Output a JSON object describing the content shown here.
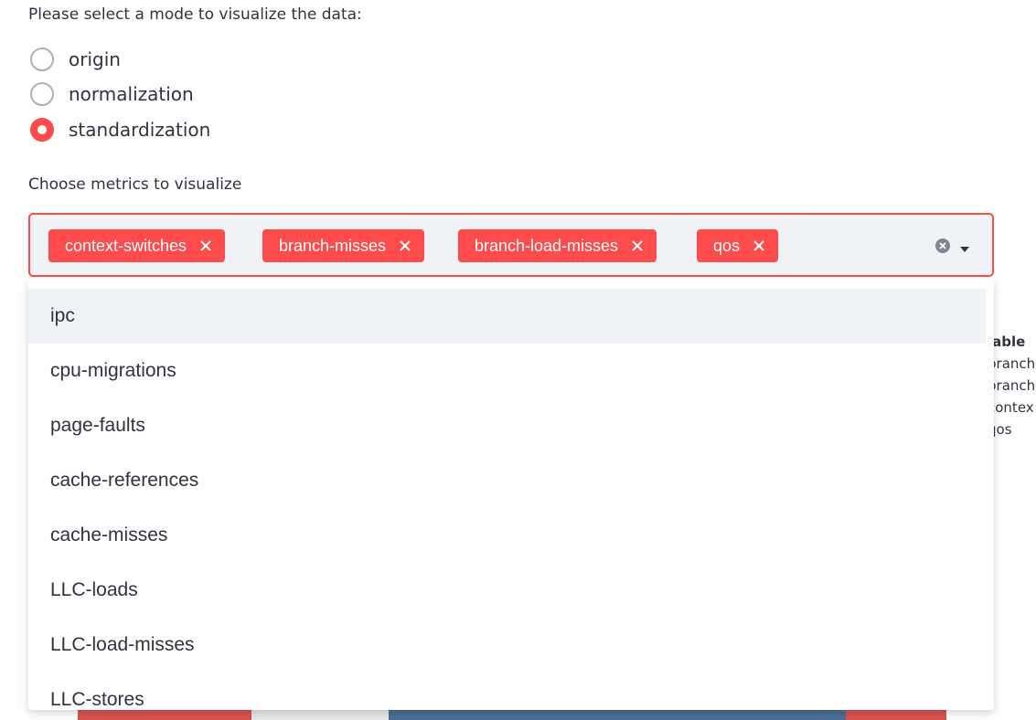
{
  "mode": {
    "prompt": "Please select a mode to visualize the data:",
    "options": [
      {
        "label": "origin",
        "selected": false
      },
      {
        "label": "normalization",
        "selected": false
      },
      {
        "label": "standardization",
        "selected": true
      }
    ]
  },
  "metrics": {
    "label": "Choose metrics to visualize",
    "selected": [
      "context-switches",
      "branch-misses",
      "branch-load-misses",
      "qos"
    ],
    "dropdown_options": [
      "ipc",
      "cpu-migrations",
      "page-faults",
      "cache-references",
      "cache-misses",
      "LLC-loads",
      "LLC-load-misses",
      "LLC-stores"
    ]
  },
  "legend_partial": {
    "title": "iable",
    "items": [
      "branch",
      "branch",
      "contex",
      "qos"
    ]
  },
  "colors": {
    "accent": "#ff4b4b",
    "input_bg": "#f0f2f6",
    "text": "#31333f"
  }
}
